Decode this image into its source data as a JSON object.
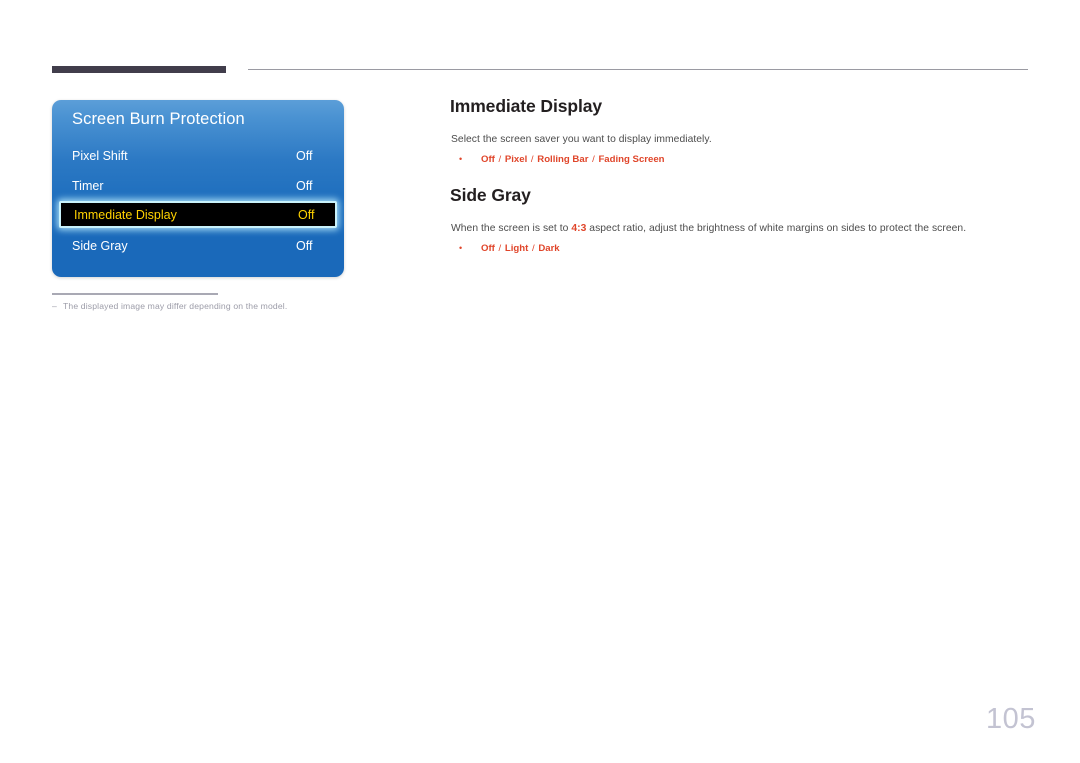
{
  "page": {
    "number": "105"
  },
  "osd": {
    "title": "Screen Burn Protection",
    "rows": [
      {
        "label": "Pixel Shift",
        "value": "Off",
        "selected": false
      },
      {
        "label": "Timer",
        "value": "Off",
        "selected": false
      },
      {
        "label": "Immediate Display",
        "value": "Off",
        "selected": true
      },
      {
        "label": "Side Gray",
        "value": "Off",
        "selected": false
      }
    ],
    "footnote": {
      "dash": "–",
      "text": "The displayed image may differ depending on the model."
    },
    "colors": {
      "panel_blue_top": "#5c9ed8",
      "panel_blue_bottom": "#1a69ba",
      "selected_background": "#000000",
      "selected_text": "#ffd200",
      "selected_glow": "#c9f2fb"
    }
  },
  "content": {
    "sections": [
      {
        "heading": "Immediate Display",
        "description_prefix": "Select the screen saver you want to display immediately.",
        "description_highlight": "",
        "description_suffix": "",
        "options": [
          "Off",
          "Pixel",
          "Rolling Bar",
          "Fading Screen"
        ],
        "separator": "/"
      },
      {
        "heading": "Side Gray",
        "description_prefix": "When the screen is set to ",
        "description_highlight": "4:3",
        "description_suffix": " aspect ratio, adjust the brightness of white margins on sides to protect the screen.",
        "options": [
          "Off",
          "Light",
          "Dark"
        ],
        "separator": "/"
      }
    ],
    "bullet_glyph": "•",
    "accent_color": "#e0452a"
  },
  "decor": {
    "top_bar_color": "#413d4b",
    "top_rule_color": "#9a9aa2"
  }
}
